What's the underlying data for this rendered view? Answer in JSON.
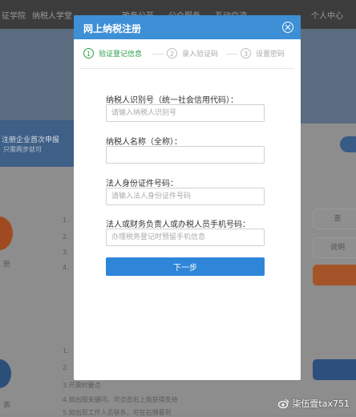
{
  "background": {
    "nav_items": [
      "征学院",
      "纳税人学堂",
      "政务公开",
      "公众服务",
      "互动交流",
      "个人中心"
    ],
    "banner_line1": "注册企业首次申报",
    "banner_line2": "只需两步就可",
    "left_text_1": "册",
    "left_text_2": "表",
    "list_items_top": [
      "1.",
      "2.",
      "3.",
      "4."
    ],
    "list_items_bottom": [
      "1.",
      "2.",
      "3.开票时要点",
      "4.如出现关键问，可点击右上角获得支持",
      "5.如出现工作人员联系，可在右侧看到"
    ],
    "right_buttons": [
      "查",
      "说明"
    ]
  },
  "watermark": {
    "text": "柒伍壹tax751"
  },
  "modal": {
    "title": "网上纳税注册",
    "steps": [
      {
        "number": "1",
        "label": "验证登记信息"
      },
      {
        "number": "2",
        "label": "录入验证码"
      },
      {
        "number": "3",
        "label": "设置密码"
      }
    ],
    "fields": [
      {
        "label": "纳税人识别号（统一社会信用代码）：",
        "placeholder": "请输入纳税人识别号",
        "value": ""
      },
      {
        "label": "纳税人名称（全称）：",
        "placeholder": "",
        "value": ""
      },
      {
        "label": "法人身份证件号码：",
        "placeholder": "请输入法人身份证件号码",
        "value": ""
      },
      {
        "label": "法人或财务负责人或办税人员手机号码：",
        "placeholder": "办理税务登记时预留手机信息",
        "value": ""
      }
    ],
    "next_button": "下一步"
  },
  "colors": {
    "header_blue": "#3d8fd6",
    "button_blue": "#2f86d8",
    "step_active_green": "#2aa048"
  }
}
